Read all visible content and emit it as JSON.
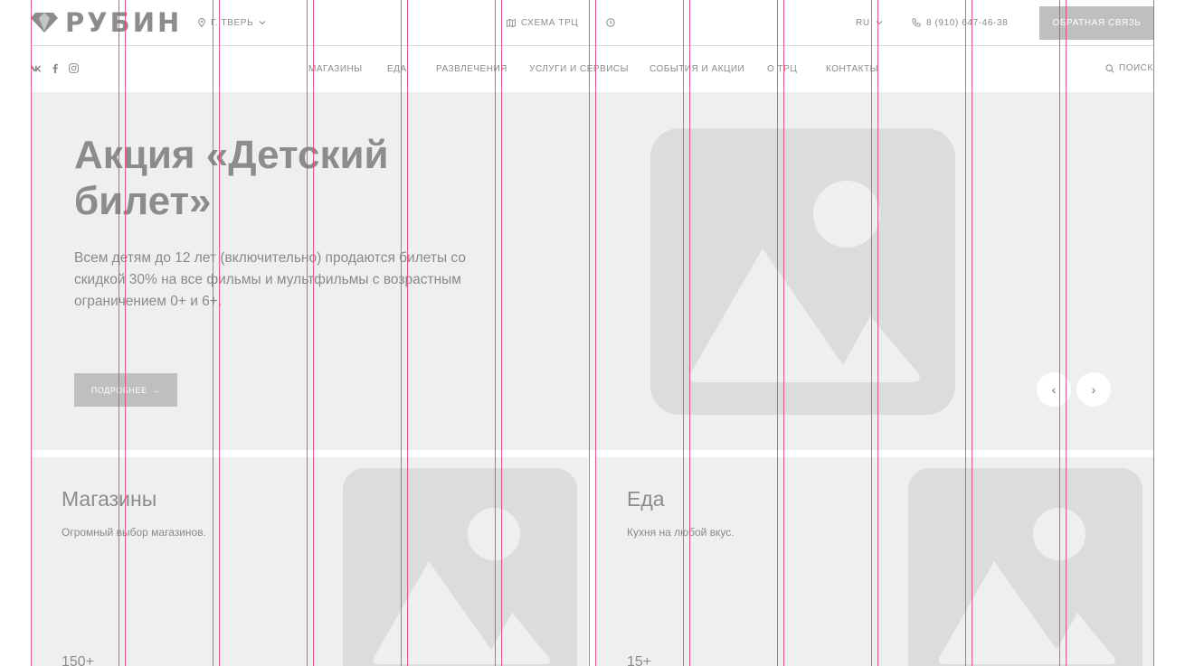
{
  "brand": {
    "name": "РУБИН"
  },
  "header": {
    "city": "Г. ТВЕРЬ",
    "scheme": "СХЕМА ТРЦ",
    "language": "RU",
    "phone": "8 (910) 647-46-38",
    "feedback_label": "ОБРАТНАЯ СВЯЗЬ"
  },
  "social": [
    {
      "label": "vk"
    },
    {
      "label": "f"
    },
    {
      "label": "instagram"
    }
  ],
  "nav": {
    "items": [
      {
        "label": "МАГАЗИНЫ"
      },
      {
        "label": "ЕДА"
      },
      {
        "label": "РАЗВЛЕЧЕНИЯ"
      },
      {
        "label": "УСЛУГИ И СЕРВИСЫ"
      },
      {
        "label": "СОБЫТИЯ И АКЦИИ"
      },
      {
        "label": "О ТРЦ"
      },
      {
        "label": "КОНТАКТЫ"
      }
    ],
    "search_label": "ПОИСК"
  },
  "hero": {
    "title": "Акция «Детский билет»",
    "text": "Всем детям до 12 лет (включительно) продаются билеты со скидкой 30% на все фильмы и мультфильмы с возрастным ограничением 0+ и 6+.",
    "button_label": "ПОДРОБНЕЕ",
    "button_arrow": "→",
    "prev_arrow": "‹",
    "next_arrow": "›"
  },
  "cards": [
    {
      "title": "Магазины",
      "subtitle": "Огромный выбор магазинов.",
      "count": "150+"
    },
    {
      "title": "Еда",
      "subtitle": "Кухня на любой вкус.",
      "count": "15+"
    }
  ],
  "colors": {
    "placeholder_bg": "#efefef",
    "placeholder_icon": "#dcdcdc",
    "button_bg": "#bfbfbf",
    "text": "#8a8a8a",
    "grid_line": "#e0407a"
  }
}
